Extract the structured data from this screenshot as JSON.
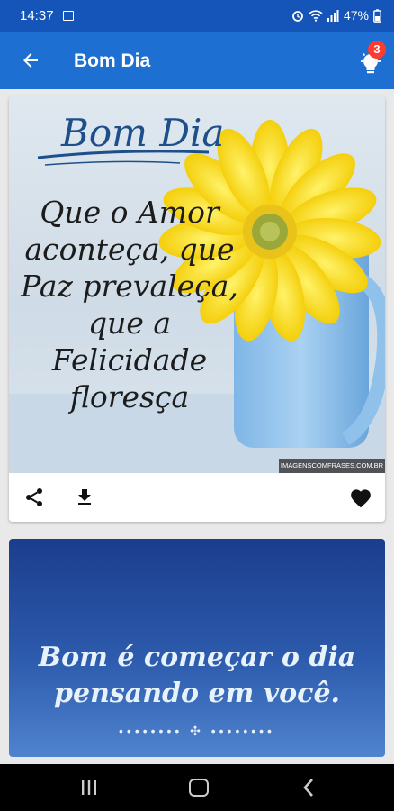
{
  "status_bar": {
    "time": "14:37",
    "battery": "47%"
  },
  "app_bar": {
    "title": "Bom Dia",
    "notification_count": "3"
  },
  "cards": [
    {
      "title_script": "Bom Dia",
      "quote_lines": [
        "Que o Amor",
        "aconteça, que",
        "Paz prevaleça,",
        "que a",
        "Felicidade",
        "floresça"
      ],
      "watermark": "IMAGENSCOMFRASES.COM.BR"
    },
    {
      "quote_lines": [
        "Bom é começar o dia",
        "pensando em você."
      ],
      "ornament": "•••••••• ✣ ••••••••"
    }
  ],
  "colors": {
    "status_bar": "#1554b8",
    "app_bar": "#1e6fd2",
    "badge": "#ff3b30"
  }
}
